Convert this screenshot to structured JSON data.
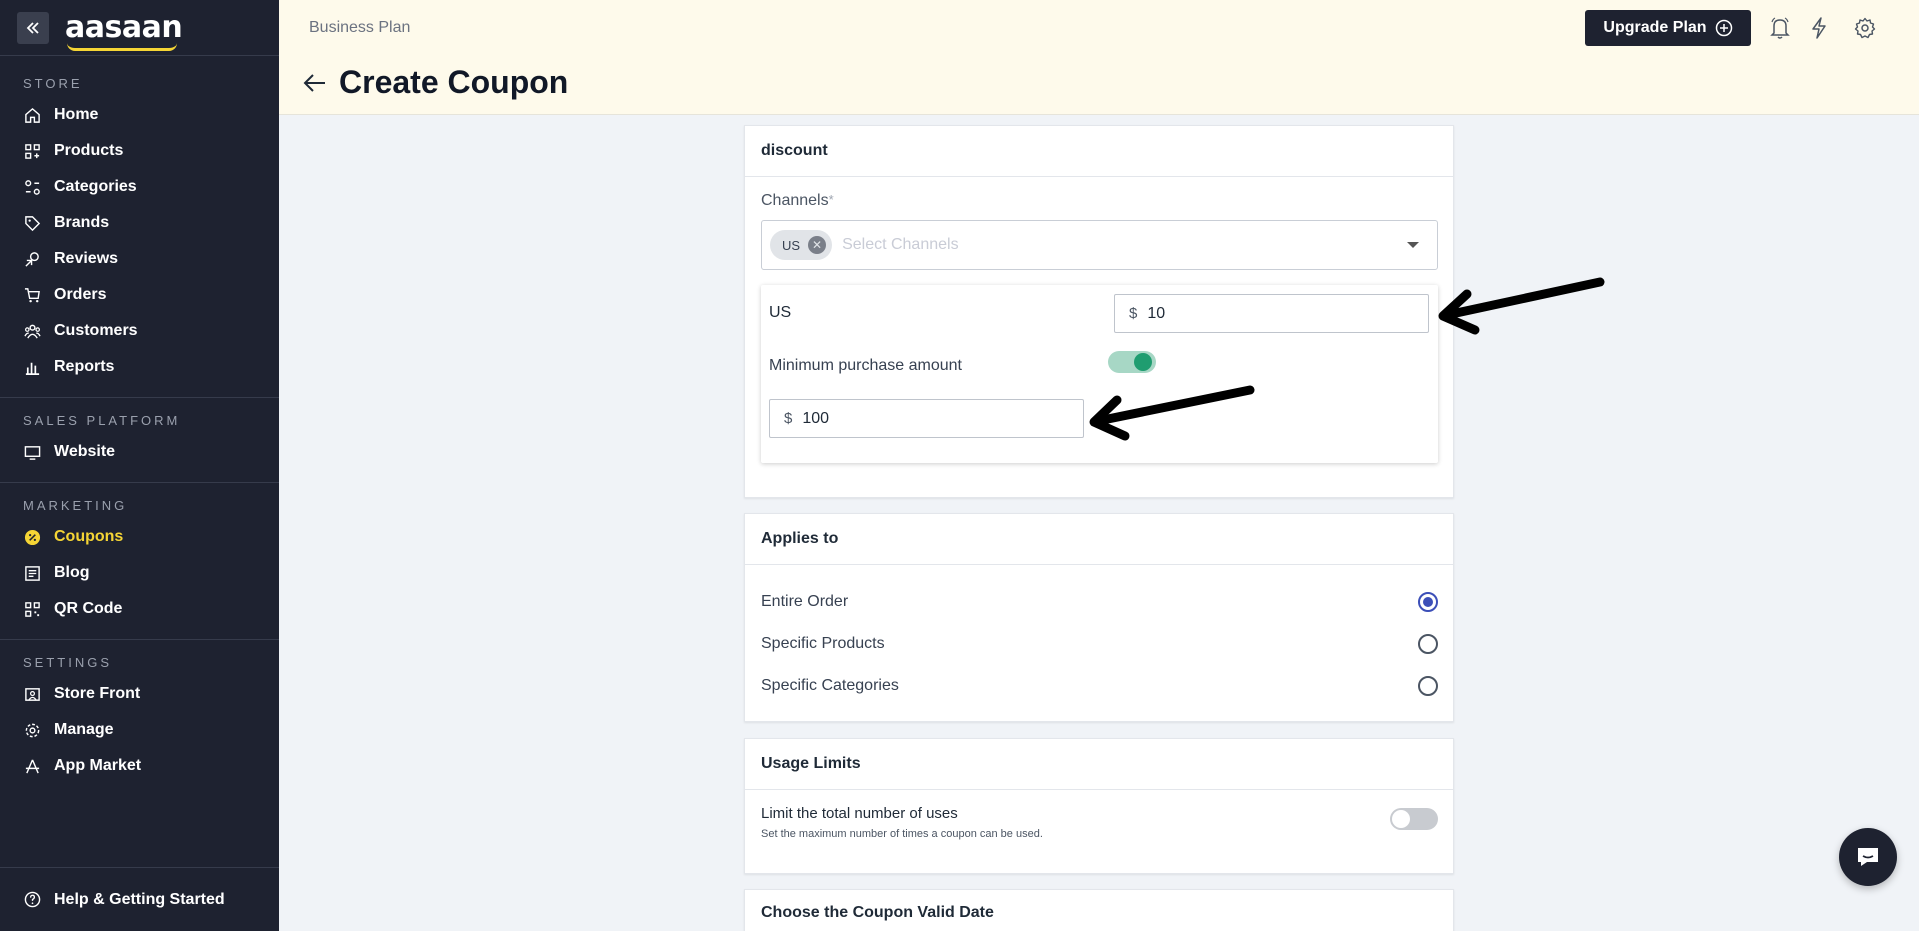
{
  "sidebar": {
    "logo": "aasaan",
    "sections": [
      {
        "heading": "STORE",
        "items": [
          {
            "label": "Home",
            "icon": "home-icon"
          },
          {
            "label": "Products",
            "icon": "products-icon"
          },
          {
            "label": "Categories",
            "icon": "categories-icon"
          },
          {
            "label": "Brands",
            "icon": "tag-icon"
          },
          {
            "label": "Reviews",
            "icon": "reviews-icon"
          },
          {
            "label": "Orders",
            "icon": "cart-icon"
          },
          {
            "label": "Customers",
            "icon": "users-icon"
          },
          {
            "label": "Reports",
            "icon": "bar-chart-icon"
          }
        ]
      },
      {
        "heading": "SALES PLATFORM",
        "items": [
          {
            "label": "Website",
            "icon": "monitor-icon"
          }
        ]
      },
      {
        "heading": "MARKETING",
        "items": [
          {
            "label": "Coupons",
            "icon": "coupon-badge-icon",
            "active": true
          },
          {
            "label": "Blog",
            "icon": "blog-icon"
          },
          {
            "label": "QR Code",
            "icon": "qr-code-icon"
          }
        ]
      },
      {
        "heading": "SETTINGS",
        "items": [
          {
            "label": "Store Front",
            "icon": "storefront-icon"
          },
          {
            "label": "Manage",
            "icon": "gear-icon"
          },
          {
            "label": "App Market",
            "icon": "app-market-icon"
          }
        ]
      }
    ],
    "help_label": "Help & Getting Started"
  },
  "header": {
    "plan": "Business Plan",
    "upgrade_label": "Upgrade Plan",
    "page_title": "Create Coupon"
  },
  "discount_card": {
    "title": "discount",
    "channels_label": "Channels",
    "required_mark": "*",
    "selected_chip": "US",
    "placeholder": "Select Channels",
    "channel_name": "US",
    "currency": "$",
    "discount_value": "10",
    "min_purchase_label": "Minimum purchase amount",
    "min_purchase_enabled": true,
    "min_purchase_value": "100"
  },
  "applies_card": {
    "title": "Applies to",
    "options": [
      {
        "label": "Entire Order",
        "checked": true
      },
      {
        "label": "Specific Products",
        "checked": false
      },
      {
        "label": "Specific Categories",
        "checked": false
      }
    ]
  },
  "usage_card": {
    "title": "Usage Limits",
    "limit_label": "Limit the total number of uses",
    "limit_help": "Set the maximum number of times a coupon can be used.",
    "limit_enabled": false
  },
  "valid_card": {
    "title": "Choose the Coupon Valid Date"
  },
  "colors": {
    "sidebar_bg": "#1e2230",
    "active": "#f5d535",
    "header_bg": "#fefaeb",
    "toggle_on": "#1f9d70",
    "radio_checked": "#3c4fb8"
  }
}
